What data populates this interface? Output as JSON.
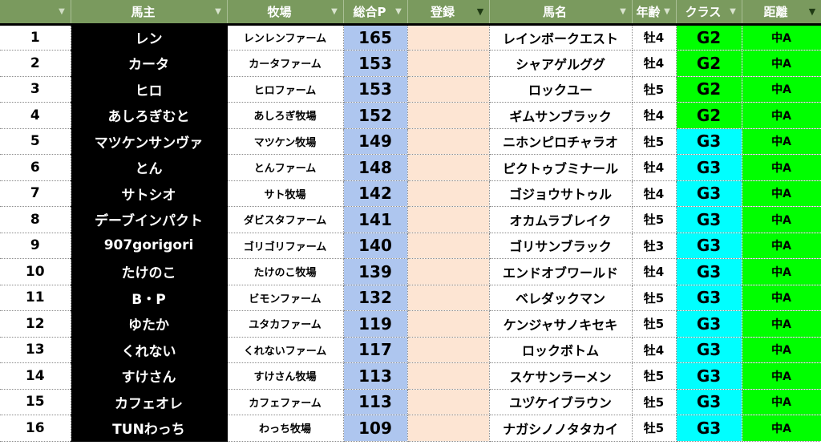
{
  "table": {
    "headers": {
      "rank": "",
      "owner": "馬主",
      "farm": "牧場",
      "points": "総合P",
      "registration": "登録",
      "horse": "馬名",
      "age": "年齢",
      "class": "クラス",
      "distance": "距離"
    },
    "rows": [
      {
        "rank": "1",
        "owner": "レン",
        "farm": "レンレンファーム",
        "points": "165",
        "registration": "",
        "horse": "レインボークエスト",
        "age": "牡4",
        "class": "G2",
        "distance": "中A"
      },
      {
        "rank": "2",
        "owner": "カータ",
        "farm": "カータファーム",
        "points": "153",
        "registration": "",
        "horse": "シャアゲルググ",
        "age": "牡4",
        "class": "G2",
        "distance": "中A"
      },
      {
        "rank": "3",
        "owner": "ヒロ",
        "farm": "ヒロファーム",
        "points": "153",
        "registration": "",
        "horse": "ロックユー",
        "age": "牡5",
        "class": "G2",
        "distance": "中A"
      },
      {
        "rank": "4",
        "owner": "あしろぎむと",
        "farm": "あしろぎ牧場",
        "points": "152",
        "registration": "",
        "horse": "ギムサンブラック",
        "age": "牡4",
        "class": "G2",
        "distance": "中A"
      },
      {
        "rank": "5",
        "owner": "マツケンサンヴァ",
        "farm": "マツケン牧場",
        "points": "149",
        "registration": "",
        "horse": "ニホンピロチャラオ",
        "age": "牡5",
        "class": "G3",
        "distance": "中A"
      },
      {
        "rank": "6",
        "owner": "とん",
        "farm": "とんファーム",
        "points": "148",
        "registration": "",
        "horse": "ピクトゥブミナール",
        "age": "牡4",
        "class": "G3",
        "distance": "中A"
      },
      {
        "rank": "7",
        "owner": "サトシオ",
        "farm": "サト牧場",
        "points": "142",
        "registration": "",
        "horse": "ゴジョウサトゥル",
        "age": "牡4",
        "class": "G3",
        "distance": "中A"
      },
      {
        "rank": "8",
        "owner": "デーブインパクト",
        "farm": "ダビスタファーム",
        "points": "141",
        "registration": "",
        "horse": "オカムラブレイク",
        "age": "牡5",
        "class": "G3",
        "distance": "中A"
      },
      {
        "rank": "9",
        "owner": "907gorigori",
        "farm": "ゴリゴリファーム",
        "points": "140",
        "registration": "",
        "horse": "ゴリサンブラック",
        "age": "牡3",
        "class": "G3",
        "distance": "中A"
      },
      {
        "rank": "10",
        "owner": "たけのこ",
        "farm": "たけのこ牧場",
        "points": "139",
        "registration": "",
        "horse": "エンドオブワールド",
        "age": "牡4",
        "class": "G3",
        "distance": "中A"
      },
      {
        "rank": "11",
        "owner": "B・P",
        "farm": "ビモンファーム",
        "points": "132",
        "registration": "",
        "horse": "ベレダックマン",
        "age": "牡5",
        "class": "G3",
        "distance": "中A"
      },
      {
        "rank": "12",
        "owner": "ゆたか",
        "farm": "ユタカファーム",
        "points": "119",
        "registration": "",
        "horse": "ケンジャサノキセキ",
        "age": "牡5",
        "class": "G3",
        "distance": "中A"
      },
      {
        "rank": "13",
        "owner": "くれない",
        "farm": "くれないファーム",
        "points": "117",
        "registration": "",
        "horse": "ロックボトム",
        "age": "牡4",
        "class": "G3",
        "distance": "中A"
      },
      {
        "rank": "14",
        "owner": "すけさん",
        "farm": "すけさん牧場",
        "points": "113",
        "registration": "",
        "horse": "スケサンラーメン",
        "age": "牡5",
        "class": "G3",
        "distance": "中A"
      },
      {
        "rank": "15",
        "owner": "カフェオレ",
        "farm": "カフェファーム",
        "points": "113",
        "registration": "",
        "horse": "ユヅケイブラウン",
        "age": "牡5",
        "class": "G3",
        "distance": "中A"
      },
      {
        "rank": "16",
        "owner": "TUNわっち",
        "farm": "わっち牧場",
        "points": "109",
        "registration": "",
        "horse": "ナガシノノタタカイ",
        "age": "牡5",
        "class": "G3",
        "distance": "中A"
      }
    ]
  },
  "colors": {
    "header_bg": "#7a9a5e",
    "owner_bg": "#000000",
    "points_bg": "#aec6ef",
    "registration_bg": "#fde5d3",
    "class_G2_bg": "#00ff00",
    "class_G3_bg": "#00ffff",
    "distance_bg": "#00ff00"
  },
  "icons": {
    "filter_dropdown": "filter-dropdown-icon",
    "filter_active": "filter-active-icon"
  }
}
